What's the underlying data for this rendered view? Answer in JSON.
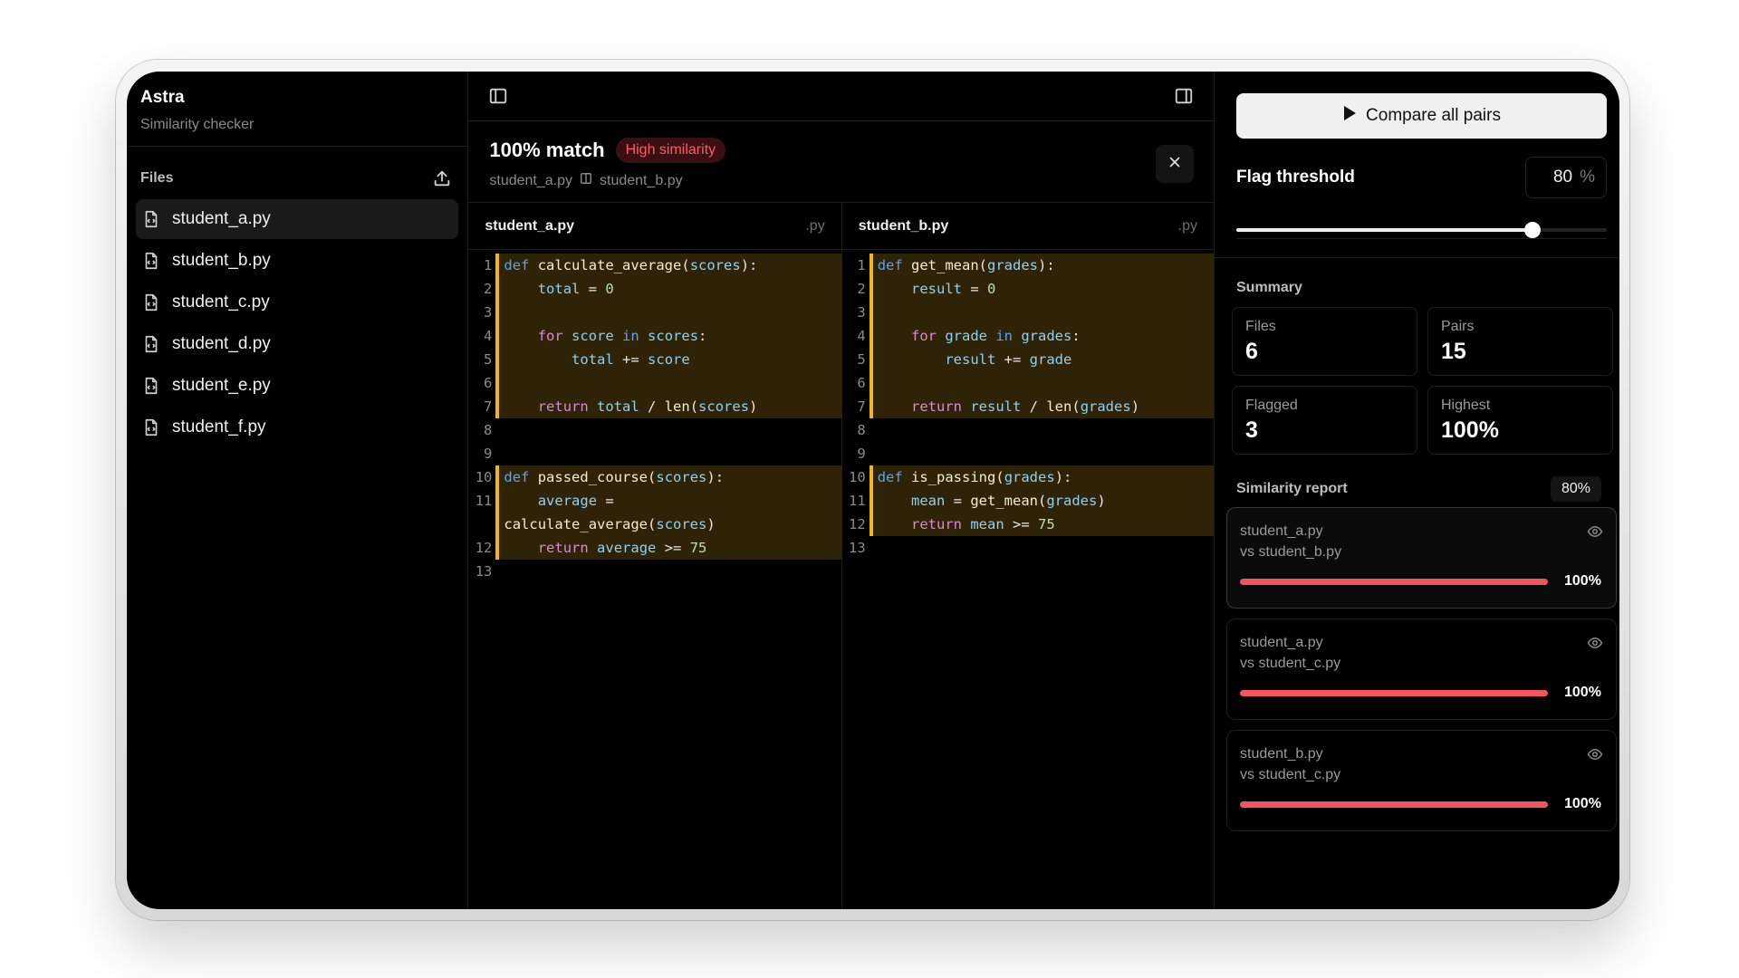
{
  "app": {
    "name": "Astra",
    "subtitle": "Similarity checker"
  },
  "files": {
    "title": "Files",
    "items": [
      {
        "label": "student_a.py",
        "active": true
      },
      {
        "label": "student_b.py"
      },
      {
        "label": "student_c.py"
      },
      {
        "label": "student_d.py"
      },
      {
        "label": "student_e.py"
      },
      {
        "label": "student_f.py"
      }
    ]
  },
  "match": {
    "title": "100% match",
    "badge": "High similarity",
    "file_a": "student_a.py",
    "file_b": "student_b.py"
  },
  "panes": {
    "left": {
      "name": "student_a.py",
      "ext": ".py",
      "lines": [
        {
          "n": "1",
          "hl": true,
          "code": [
            [
              "kd",
              "def "
            ],
            [
              "fn",
              "calculate_average"
            ],
            [
              "",
              "("
            ],
            [
              "id",
              "scores"
            ],
            [
              "",
              "):"
            ]
          ]
        },
        {
          "n": "2",
          "hl": true,
          "code": [
            [
              "",
              "    "
            ],
            [
              "id",
              "total"
            ],
            [
              "",
              " = "
            ],
            [
              "nm",
              "0"
            ]
          ]
        },
        {
          "n": "3",
          "hl": true,
          "code": []
        },
        {
          "n": "4",
          "hl": true,
          "code": [
            [
              "",
              "    "
            ],
            [
              "kw",
              "for "
            ],
            [
              "id",
              "score "
            ],
            [
              "kd",
              "in "
            ],
            [
              "id",
              "scores"
            ],
            [
              "",
              ":"
            ]
          ]
        },
        {
          "n": "5",
          "hl": true,
          "code": [
            [
              "",
              "        "
            ],
            [
              "id",
              "total"
            ],
            [
              "",
              " += "
            ],
            [
              "id",
              "score"
            ]
          ]
        },
        {
          "n": "6",
          "hl": true,
          "code": []
        },
        {
          "n": "7",
          "hl": true,
          "code": [
            [
              "",
              "    "
            ],
            [
              "kw",
              "return "
            ],
            [
              "id",
              "total"
            ],
            [
              "",
              " / "
            ],
            [
              "fn",
              "len"
            ],
            [
              "",
              "("
            ],
            [
              "id",
              "scores"
            ],
            [
              "",
              ")"
            ]
          ]
        },
        {
          "n": "8",
          "hl": false,
          "code": []
        },
        {
          "n": "9",
          "hl": false,
          "code": []
        },
        {
          "n": "10",
          "hl": true,
          "code": [
            [
              "kd",
              "def "
            ],
            [
              "fn",
              "passed_course"
            ],
            [
              "",
              "("
            ],
            [
              "id",
              "scores"
            ],
            [
              "",
              "):"
            ]
          ]
        },
        {
          "n": "11",
          "hl": true,
          "code": [
            [
              "",
              "    "
            ],
            [
              "id",
              "average"
            ],
            [
              "",
              " ="
            ]
          ]
        },
        {
          "n": "",
          "hl": true,
          "code": [
            [
              "fn",
              "calculate_average"
            ],
            [
              "",
              "("
            ],
            [
              "id",
              "scores"
            ],
            [
              "",
              ")"
            ]
          ]
        },
        {
          "n": "12",
          "hl": true,
          "code": [
            [
              "",
              "    "
            ],
            [
              "kw",
              "return "
            ],
            [
              "id",
              "average"
            ],
            [
              "",
              " >= "
            ],
            [
              "nm",
              "75"
            ]
          ]
        },
        {
          "n": "13",
          "hl": false,
          "code": []
        }
      ]
    },
    "right": {
      "name": "student_b.py",
      "ext": ".py",
      "lines": [
        {
          "n": "1",
          "hl": true,
          "code": [
            [
              "kd",
              "def "
            ],
            [
              "fn",
              "get_mean"
            ],
            [
              "",
              "("
            ],
            [
              "id",
              "grades"
            ],
            [
              "",
              "):"
            ]
          ]
        },
        {
          "n": "2",
          "hl": true,
          "code": [
            [
              "",
              "    "
            ],
            [
              "id",
              "result"
            ],
            [
              "",
              " = "
            ],
            [
              "nm",
              "0"
            ]
          ]
        },
        {
          "n": "3",
          "hl": true,
          "code": []
        },
        {
          "n": "4",
          "hl": true,
          "code": [
            [
              "",
              "    "
            ],
            [
              "kw",
              "for "
            ],
            [
              "id",
              "grade "
            ],
            [
              "kd",
              "in "
            ],
            [
              "id",
              "grades"
            ],
            [
              "",
              ":"
            ]
          ]
        },
        {
          "n": "5",
          "hl": true,
          "code": [
            [
              "",
              "        "
            ],
            [
              "id",
              "result"
            ],
            [
              "",
              " += "
            ],
            [
              "id",
              "grade"
            ]
          ]
        },
        {
          "n": "6",
          "hl": true,
          "code": []
        },
        {
          "n": "7",
          "hl": true,
          "code": [
            [
              "",
              "    "
            ],
            [
              "kw",
              "return "
            ],
            [
              "id",
              "result"
            ],
            [
              "",
              " / "
            ],
            [
              "fn",
              "len"
            ],
            [
              "",
              "("
            ],
            [
              "id",
              "grades"
            ],
            [
              "",
              ")"
            ]
          ]
        },
        {
          "n": "8",
          "hl": false,
          "code": []
        },
        {
          "n": "9",
          "hl": false,
          "code": []
        },
        {
          "n": "10",
          "hl": true,
          "code": [
            [
              "kd",
              "def "
            ],
            [
              "fn",
              "is_passing"
            ],
            [
              "",
              "("
            ],
            [
              "id",
              "grades"
            ],
            [
              "",
              "):"
            ]
          ]
        },
        {
          "n": "11",
          "hl": true,
          "code": [
            [
              "",
              "    "
            ],
            [
              "id",
              "mean"
            ],
            [
              "",
              " = "
            ],
            [
              "fn",
              "get_mean"
            ],
            [
              "",
              "("
            ],
            [
              "id",
              "grades"
            ],
            [
              "",
              ")"
            ]
          ]
        },
        {
          "n": "12",
          "hl": true,
          "code": [
            [
              "",
              "    "
            ],
            [
              "kw",
              "return "
            ],
            [
              "id",
              "mean"
            ],
            [
              "",
              " >= "
            ],
            [
              "nm",
              "75"
            ]
          ]
        },
        {
          "n": "13",
          "hl": false,
          "code": []
        }
      ]
    }
  },
  "controls": {
    "compare_label": "Compare all pairs",
    "threshold_label": "Flag threshold",
    "threshold_value": "80",
    "threshold_unit": "%",
    "threshold_fraction": 0.8
  },
  "summary": {
    "title": "Summary",
    "cards": [
      {
        "label": "Files",
        "value": "6"
      },
      {
        "label": "Pairs",
        "value": "15"
      },
      {
        "label": "Flagged",
        "value": "3"
      },
      {
        "label": "Highest",
        "value": "100%"
      }
    ]
  },
  "report": {
    "title": "Similarity report",
    "threshold": "80%",
    "items": [
      {
        "a": "student_a.py",
        "b": "vs student_b.py",
        "value": "100%",
        "fraction": 1.0,
        "selected": true
      },
      {
        "a": "student_a.py",
        "b": "vs student_c.py",
        "value": "100%",
        "fraction": 1.0
      },
      {
        "a": "student_b.py",
        "b": "vs student_c.py",
        "value": "100%",
        "fraction": 1.0
      }
    ]
  },
  "colors": {
    "accent_highlight": "#f2b418",
    "danger": "#f2545e",
    "badge_text": "#ff5a66"
  },
  "icons": {
    "file": "file-code-icon",
    "upload": "upload-icon",
    "sidebar_toggle": "sidebar-left-icon",
    "panel_toggle": "sidebar-right-icon",
    "close": "close-icon",
    "play": "play-icon",
    "eye": "eye-icon",
    "columns": "columns-icon"
  }
}
